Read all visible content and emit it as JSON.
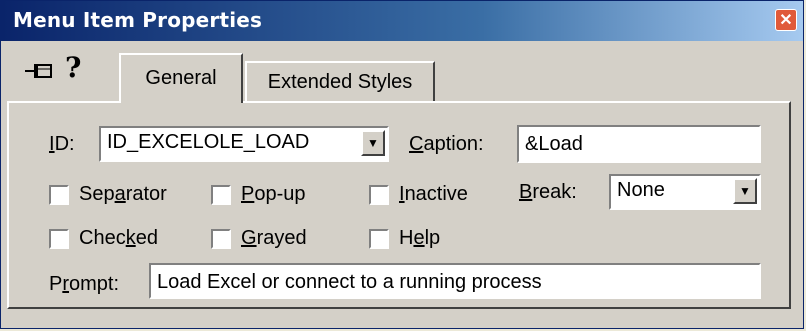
{
  "window": {
    "title": "Menu Item Properties",
    "close_glyph": "✕"
  },
  "toolbar": {
    "pin_icon": "push-pin-icon",
    "help_icon": "help-icon",
    "pin_glyph": "⊣⊠",
    "help_glyph": "?"
  },
  "tabs": [
    {
      "label": "General",
      "active": true
    },
    {
      "label": "Extended Styles",
      "active": false
    }
  ],
  "general": {
    "id_label": "ID:",
    "id_value": "ID_EXCELOLE_LOAD",
    "caption_label": "Caption:",
    "caption_value": "&Load",
    "break_label": "Break:",
    "break_value": "None",
    "prompt_label": "Prompt:",
    "prompt_value": "Load Excel or connect to a running process",
    "checkboxes": [
      {
        "label": "Separator",
        "checked": false
      },
      {
        "label": "Pop-up",
        "checked": false
      },
      {
        "label": "Inactive",
        "checked": false
      },
      {
        "label": "Checked",
        "checked": false
      },
      {
        "label": "Grayed",
        "checked": false
      },
      {
        "label": "Help",
        "checked": false
      }
    ]
  },
  "colors": {
    "title_bar": "#0a246a",
    "face": "#d4d0c8"
  }
}
